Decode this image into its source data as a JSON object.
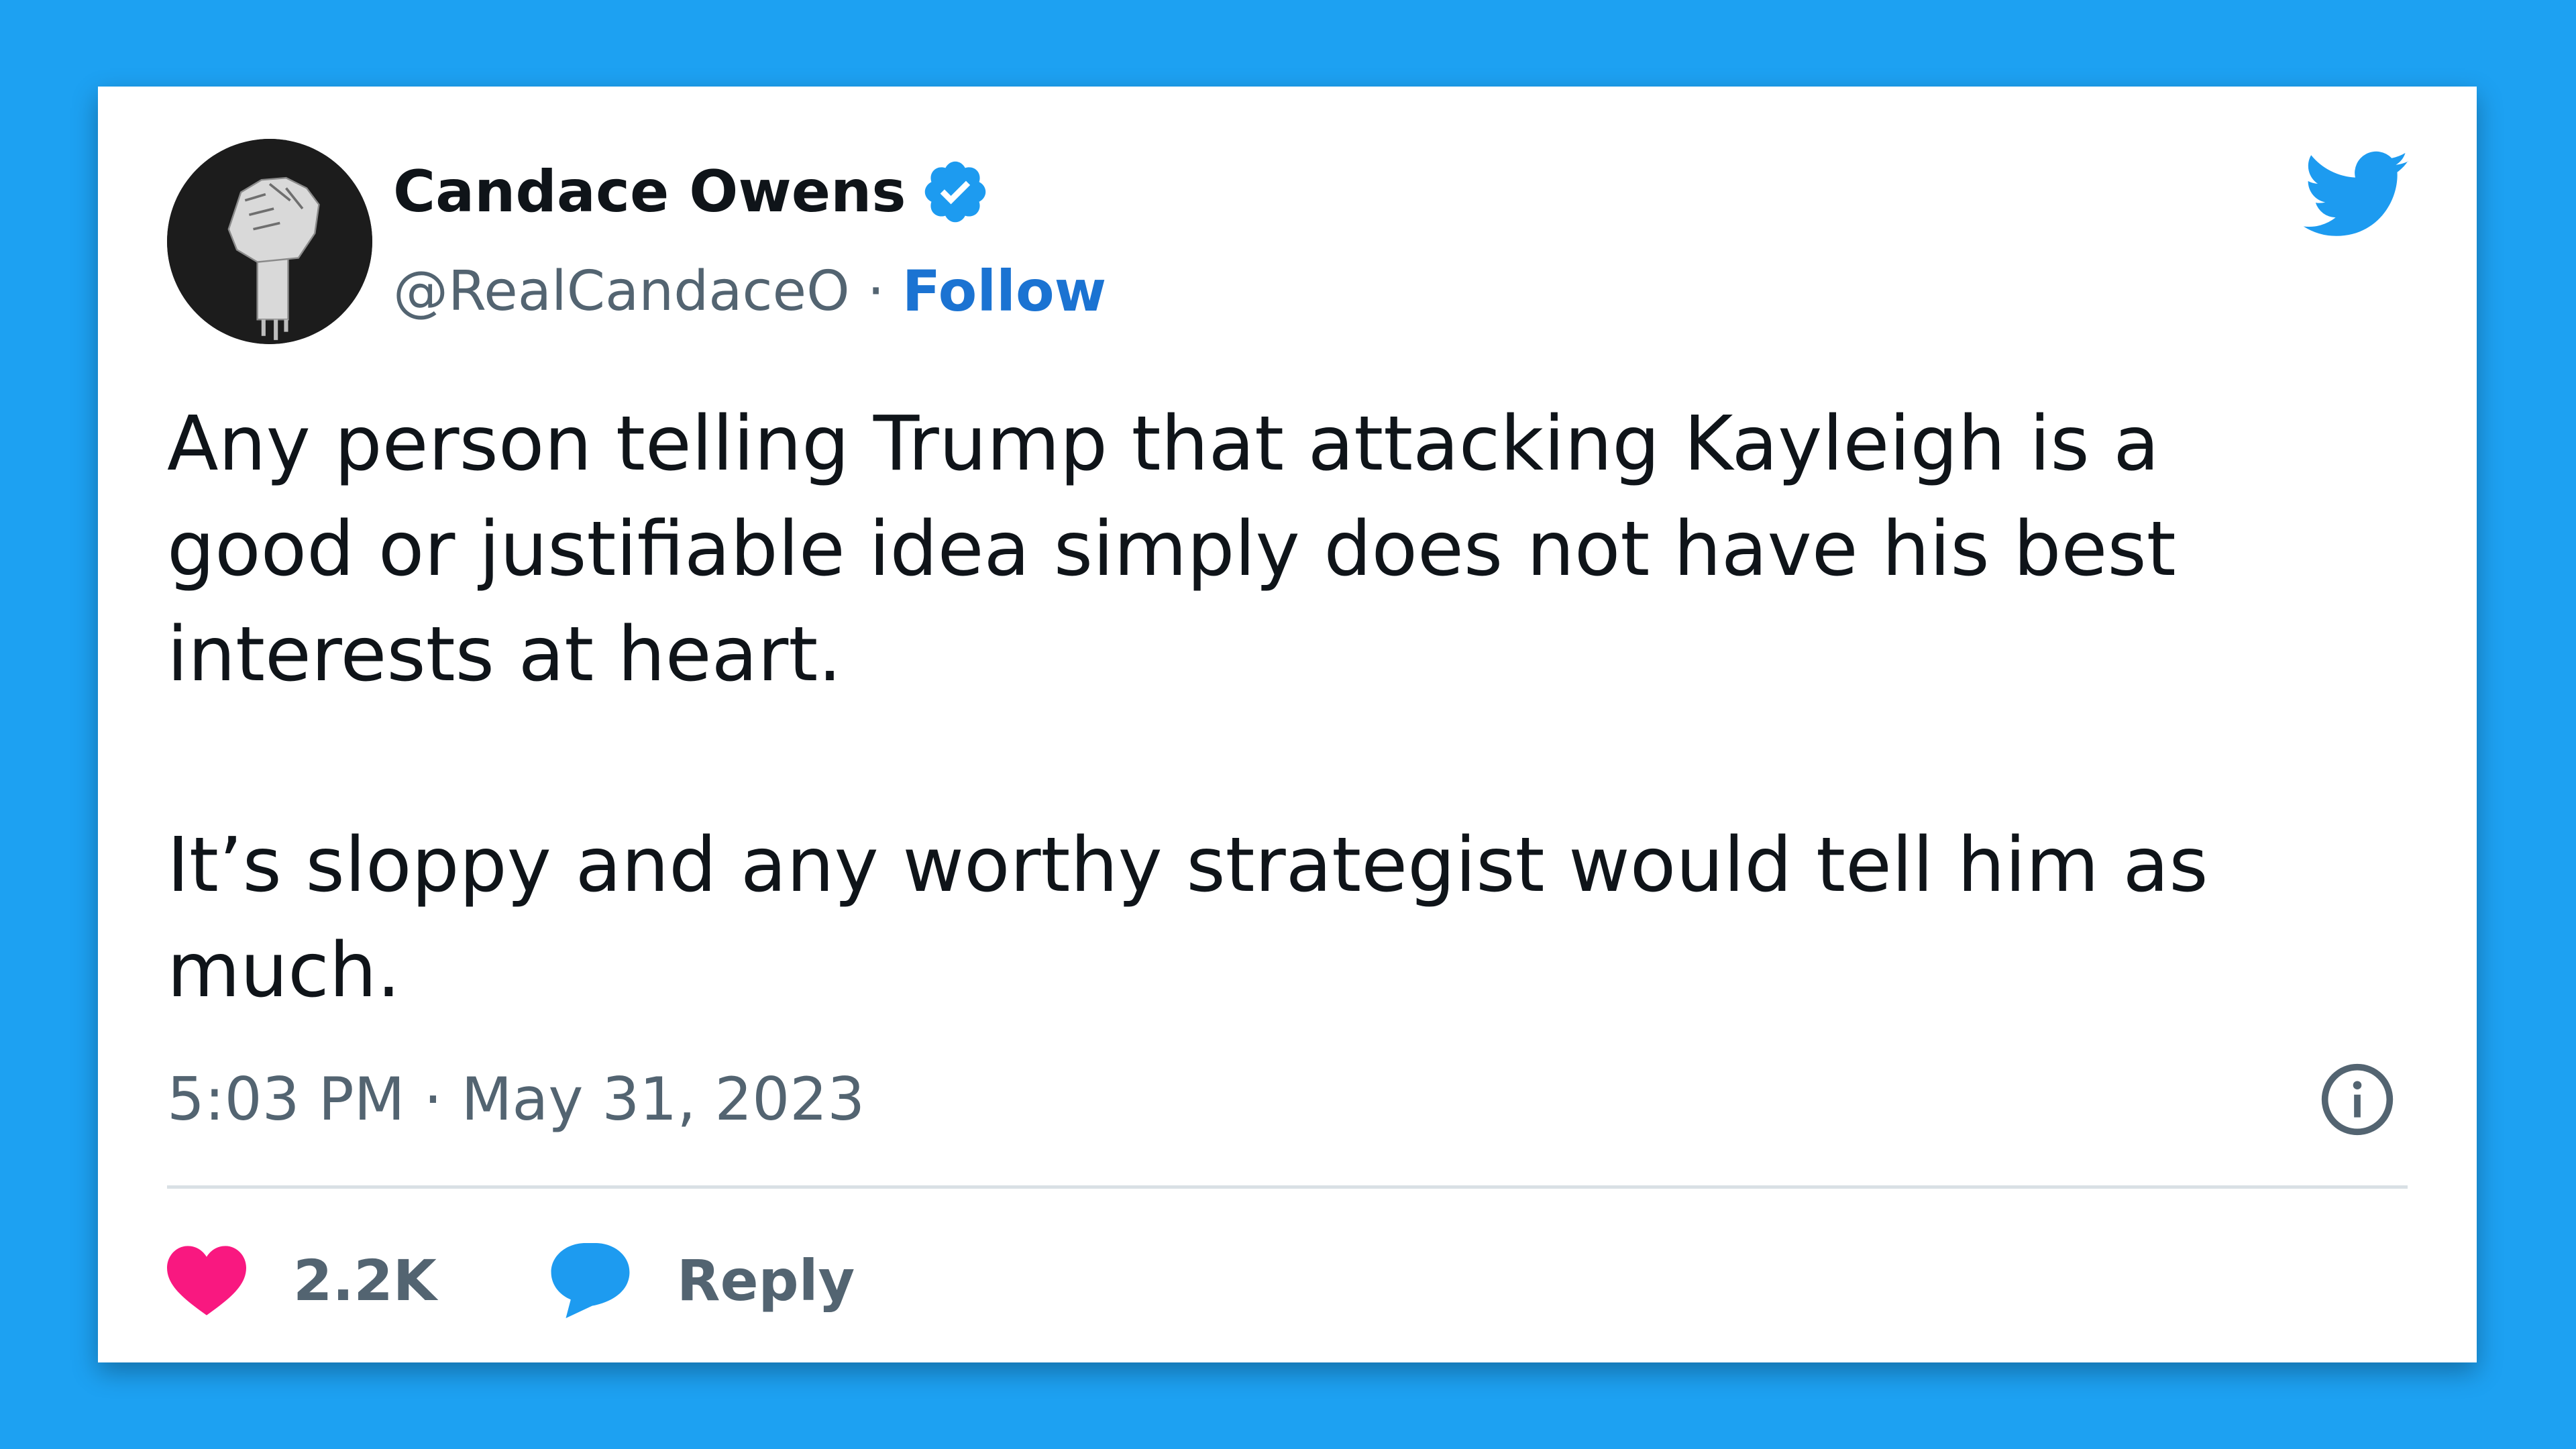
{
  "tweet": {
    "author": {
      "name": "Candace Owens",
      "handle": "@RealCandaceO",
      "verified": true
    },
    "follow_label": "Follow",
    "separator": "·",
    "text": [
      "Any person telling Trump that attacking Kayleigh is a good or justifiable idea simply does not have his best interests at heart.",
      "It’s sloppy and any worthy strategist would tell him as much."
    ],
    "text_lines": [
      [
        "Any person telling Trump that attacking Kayleigh is a",
        "good or justifiable idea simply does not have his best",
        "interests at heart."
      ],
      [
        "It’s sloppy and any worthy strategist would tell him as",
        "much."
      ]
    ],
    "timestamp": "5:03 PM · May 31, 2023",
    "likes": "2.2K",
    "reply_label": "Reply"
  },
  "icons": {
    "platform": "twitter-bird-icon",
    "verified": "verified-badge-icon",
    "info": "info-icon",
    "like": "heart-icon",
    "reply": "reply-bubble-icon",
    "avatar": "raised-fist-image"
  },
  "colors": {
    "background": "#1da1f2",
    "card": "#ffffff",
    "primary_text": "#0f1419",
    "secondary_text": "#536471",
    "link": "#1b73d2",
    "brand_blue": "#1d9bf0",
    "like_pink": "#f91880",
    "divider": "#d9e0e5"
  }
}
